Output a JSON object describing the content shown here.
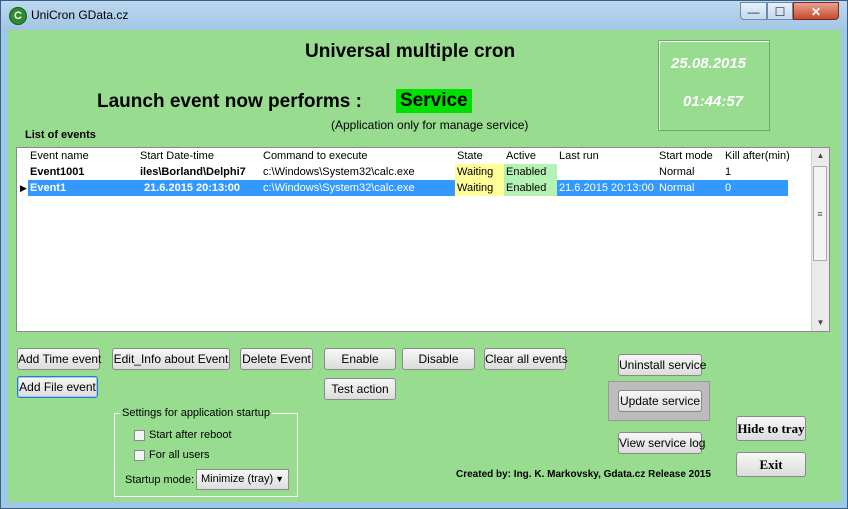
{
  "window": {
    "title": "UniCron GData.cz",
    "icon": "unicron-app-icon"
  },
  "header": {
    "main_title": "Universal multiple cron",
    "launch_label": "Launch event now performs :",
    "mode_badge": "Service",
    "mode_note": "(Application only for manage service)",
    "mode_badge_color": "#00e000"
  },
  "clock": {
    "date": "25.08.2015",
    "time": "01:44:57"
  },
  "events": {
    "section_label": "List of events",
    "columns": [
      "Event name",
      "Start Date-time",
      "Command to execute",
      "State",
      "Active",
      "Last run",
      "Start mode",
      "Kill after(min)"
    ],
    "rows": [
      {
        "name": "Event1001",
        "start": "iles\\Borland\\Delphi7",
        "command": "c:\\Windows\\System32\\calc.exe",
        "state": "Waiting",
        "active": "Enabled",
        "last_run": "",
        "start_mode": "Normal",
        "kill_after": "1"
      },
      {
        "name": "Event1",
        "start": "21.6.2015 20:13:00",
        "command": "c:\\Windows\\System32\\calc.exe",
        "state": "Waiting",
        "active": "Enabled",
        "last_run": "21.6.2015 20:13:00",
        "start_mode": "Normal",
        "kill_after": "0"
      }
    ],
    "selected_row_color": "#3399ff",
    "state_color": "#ffff99",
    "active_color": "#b4f2b4"
  },
  "buttons": {
    "add_time_event": "Add Time event",
    "add_file_event": "Add File event",
    "edit_info": "Edit_Info about Event",
    "delete_event": "Delete Event",
    "enable": "Enable",
    "disable": "Disable",
    "clear_all": "Clear all events",
    "test_action": "Test action",
    "uninstall_service": "Uninstall service",
    "update_service": "Update service",
    "view_service_log": "View service log",
    "hide_to_tray": "Hide to tray",
    "exit": "Exit"
  },
  "startup": {
    "group_title": "Settings for application startup",
    "start_after_reboot": "Start after reboot",
    "for_all_users": "For all users",
    "mode_label": "Startup mode:",
    "mode_value": "Minimize (tray)"
  },
  "footer": {
    "credits": "Created by: Ing. K. Markovsky, Gdata.cz Release 2015"
  },
  "theme": {
    "background": "#98dc8f"
  }
}
